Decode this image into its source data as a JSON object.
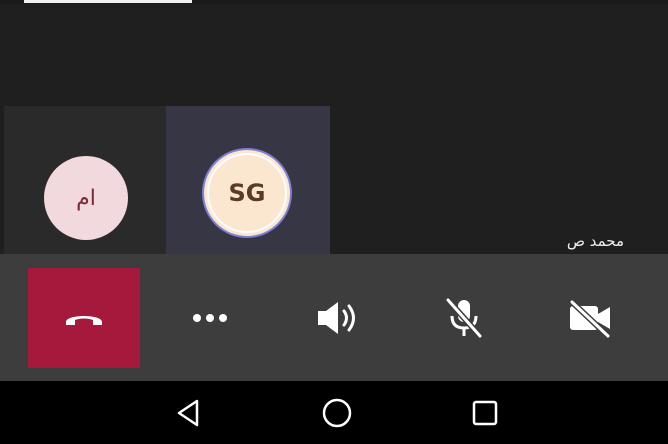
{
  "participants": [
    {
      "initials": "ام",
      "avatar_bg": "#f1d9dd"
    },
    {
      "initials": "SG",
      "avatar_bg": "#fbe7cf"
    }
  ],
  "main_video": {
    "caption": "محمد ص"
  },
  "controls": {
    "hangup": {
      "icon": "phone-hangup-icon",
      "bg": "#a4193c"
    },
    "more": {
      "icon": "more-options-icon"
    },
    "speaker": {
      "icon": "speaker-icon"
    },
    "mic": {
      "icon": "mic-off-icon"
    },
    "camera": {
      "icon": "camera-off-icon"
    }
  },
  "navbar": {
    "buttons": [
      "back-icon",
      "home-icon",
      "recents-icon"
    ]
  }
}
